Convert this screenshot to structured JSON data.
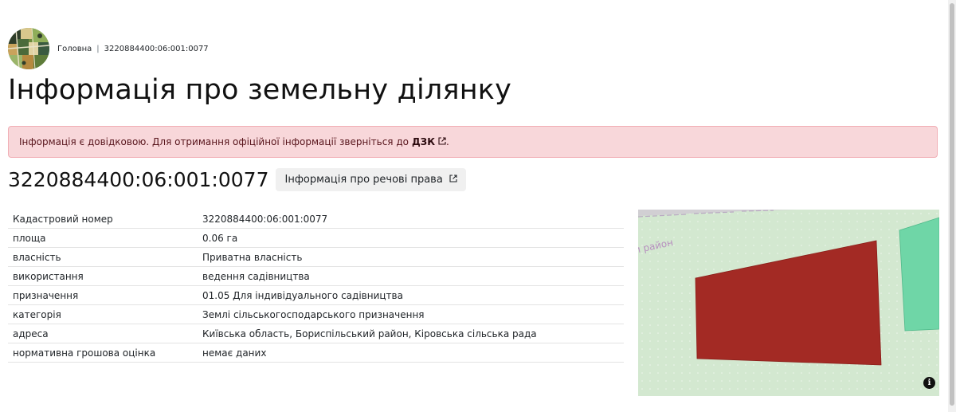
{
  "breadcrumb": {
    "home": "Головна",
    "current": "3220884400:06:001:0077"
  },
  "page_title": "Інформація про земельну ділянку",
  "alert": {
    "text": "Інформація є довідковою. Для отримання офіційної інформації зверніться до",
    "link": "ДЗК",
    "suffix": "."
  },
  "parcel": {
    "title": "3220884400:06:001:0077",
    "rights_button": "Інформація про речові права"
  },
  "table": [
    {
      "key": "Кадастровий номер",
      "value": "3220884400:06:001:0077"
    },
    {
      "key": "площа",
      "value": "0.06 га"
    },
    {
      "key": "власність",
      "value": "Приватна власність"
    },
    {
      "key": "використання",
      "value": "ведення садівництва"
    },
    {
      "key": "призначення",
      "value": "01.05 Для індивідуального садівництва"
    },
    {
      "key": "категорія",
      "value": "Землі сільськогосподарського призначення"
    },
    {
      "key": "адреса",
      "value": "Київська область, Бориспільський район, Кіровська сільська рада"
    },
    {
      "key": "нормативна грошова оцінка",
      "value": "немає даних"
    }
  ],
  "map": {
    "label": "й район",
    "info_icon": "i",
    "colors": {
      "background": "#d3e8d0",
      "parcel": "#a32a24",
      "neighbor": "#6fd6a7",
      "road": "#d1cfd3"
    }
  }
}
